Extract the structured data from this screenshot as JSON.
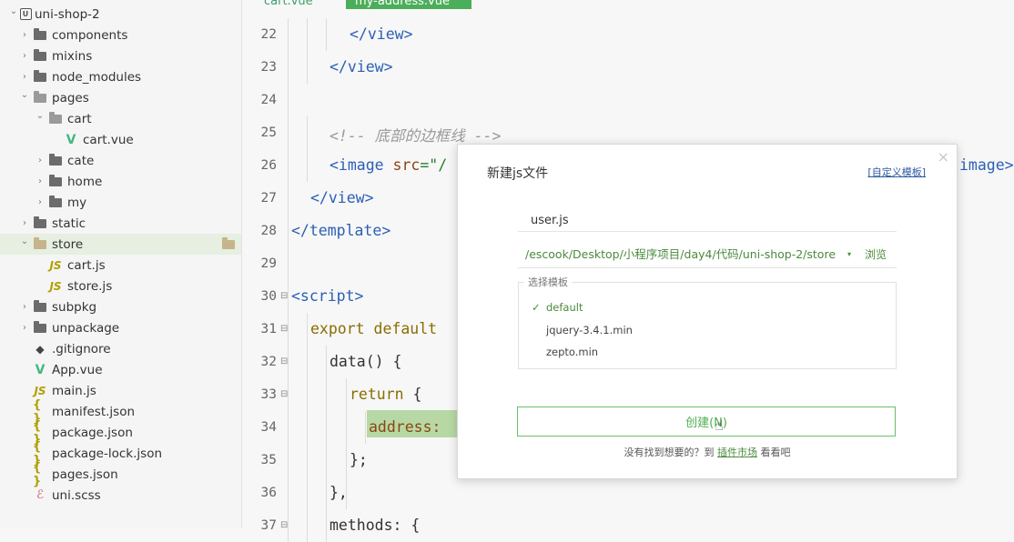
{
  "sidebar": {
    "items": [
      {
        "label": "uni-shop-2",
        "depth": 0,
        "icon": "project-icon",
        "chevron": "down"
      },
      {
        "label": "components",
        "depth": 1,
        "icon": "folder-icon",
        "chevron": "right"
      },
      {
        "label": "mixins",
        "depth": 1,
        "icon": "folder-icon",
        "chevron": "right"
      },
      {
        "label": "node_modules",
        "depth": 1,
        "icon": "folder-icon",
        "chevron": "right"
      },
      {
        "label": "pages",
        "depth": 1,
        "icon": "folder-open-icon",
        "chevron": "down"
      },
      {
        "label": "cart",
        "depth": 2,
        "icon": "folder-open-icon",
        "chevron": "down"
      },
      {
        "label": "cart.vue",
        "depth": 3,
        "icon": "vue-file-icon",
        "chevron": ""
      },
      {
        "label": "cate",
        "depth": 2,
        "icon": "folder-icon",
        "chevron": "right"
      },
      {
        "label": "home",
        "depth": 2,
        "icon": "folder-icon",
        "chevron": "right"
      },
      {
        "label": "my",
        "depth": 2,
        "icon": "folder-icon",
        "chevron": "right"
      },
      {
        "label": "static",
        "depth": 1,
        "icon": "folder-icon",
        "chevron": "right"
      },
      {
        "label": "store",
        "depth": 1,
        "icon": "folder-open-icon",
        "chevron": "down",
        "selected": true
      },
      {
        "label": "cart.js",
        "depth": 2,
        "icon": "js-file-icon",
        "chevron": ""
      },
      {
        "label": "store.js",
        "depth": 2,
        "icon": "js-file-icon",
        "chevron": ""
      },
      {
        "label": "subpkg",
        "depth": 1,
        "icon": "folder-icon",
        "chevron": "right"
      },
      {
        "label": "unpackage",
        "depth": 1,
        "icon": "folder-icon",
        "chevron": "right"
      },
      {
        "label": ".gitignore",
        "depth": 1,
        "icon": "git-file-icon",
        "chevron": ""
      },
      {
        "label": "App.vue",
        "depth": 1,
        "icon": "vue-file-icon",
        "chevron": ""
      },
      {
        "label": "main.js",
        "depth": 1,
        "icon": "js-file-icon",
        "chevron": ""
      },
      {
        "label": "manifest.json",
        "depth": 1,
        "icon": "json-file-icon",
        "chevron": ""
      },
      {
        "label": "package.json",
        "depth": 1,
        "icon": "json-file-icon",
        "chevron": ""
      },
      {
        "label": "package-lock.json",
        "depth": 1,
        "icon": "json-file-icon",
        "chevron": ""
      },
      {
        "label": "pages.json",
        "depth": 1,
        "icon": "json-file-icon",
        "chevron": ""
      },
      {
        "label": "uni.scss",
        "depth": 1,
        "icon": "scss-file-icon",
        "chevron": ""
      }
    ]
  },
  "tabs": [
    {
      "label": "cart.vue",
      "active": false
    },
    {
      "label": "my-address.vue",
      "active": true
    }
  ],
  "editor": {
    "lines": [
      {
        "num": "22",
        "fold": false,
        "tokens": [
          {
            "t": "</view>",
            "c": "tag"
          }
        ]
      },
      {
        "num": "23",
        "fold": false,
        "tokens": [
          {
            "t": "</view>",
            "c": "tag"
          }
        ]
      },
      {
        "num": "24",
        "fold": false,
        "tokens": []
      },
      {
        "num": "25",
        "fold": false,
        "tokens": [
          {
            "t": "<!-- 底部的边框线 -->",
            "c": "cmt"
          }
        ]
      },
      {
        "num": "26",
        "fold": false,
        "tokens": [
          {
            "t": "<image ",
            "c": "tag"
          },
          {
            "t": "src",
            "c": "attr"
          },
          {
            "t": "=\"/",
            "c": "str"
          }
        ]
      },
      {
        "num": "27",
        "fold": false,
        "tokens": [
          {
            "t": "</view>",
            "c": "tag"
          }
        ]
      },
      {
        "num": "28",
        "fold": false,
        "tokens": [
          {
            "t": "</template>",
            "c": "tag"
          }
        ]
      },
      {
        "num": "29",
        "fold": false,
        "tokens": []
      },
      {
        "num": "30",
        "fold": true,
        "tokens": [
          {
            "t": "<script>",
            "c": "tag"
          }
        ]
      },
      {
        "num": "31",
        "fold": true,
        "tokens": [
          {
            "t": "export default",
            "c": "kw"
          }
        ]
      },
      {
        "num": "32",
        "fold": true,
        "tokens": [
          {
            "t": "data() {",
            "c": "plain"
          }
        ]
      },
      {
        "num": "33",
        "fold": true,
        "tokens": [
          {
            "t": "return",
            "c": "kw"
          },
          {
            "t": " {",
            "c": "plain"
          }
        ]
      },
      {
        "num": "34",
        "fold": false,
        "tokens": [
          {
            "t": "address:",
            "c": "attr"
          }
        ]
      },
      {
        "num": "35",
        "fold": false,
        "tokens": [
          {
            "t": "};",
            "c": "plain"
          }
        ]
      },
      {
        "num": "36",
        "fold": false,
        "tokens": [
          {
            "t": "},",
            "c": "plain"
          }
        ]
      },
      {
        "num": "37",
        "fold": true,
        "tokens": [
          {
            "t": "methods: {",
            "c": "plain"
          }
        ]
      }
    ],
    "overflow_text": "image>"
  },
  "dialog": {
    "title": "新建js文件",
    "custom_template_link": "[自定义模板]",
    "close_glyph": "×",
    "filename_value": "user.js",
    "path_value": "/escook/Desktop/小程序项目/day4/代码/uni-shop-2/store",
    "path_dropdown_glyph": "▾",
    "browse_label": "浏览",
    "template_group_label": "选择模板",
    "templates": [
      {
        "label": "default",
        "selected": true
      },
      {
        "label": "jquery-3.4.1.min",
        "selected": false
      },
      {
        "label": "zepto.min",
        "selected": false
      }
    ],
    "check_glyph": "✓",
    "create_button_label": "创建(N)",
    "footer_prefix": "没有找到想要的？到",
    "footer_link": "插件市场",
    "footer_suffix": "看看吧"
  }
}
